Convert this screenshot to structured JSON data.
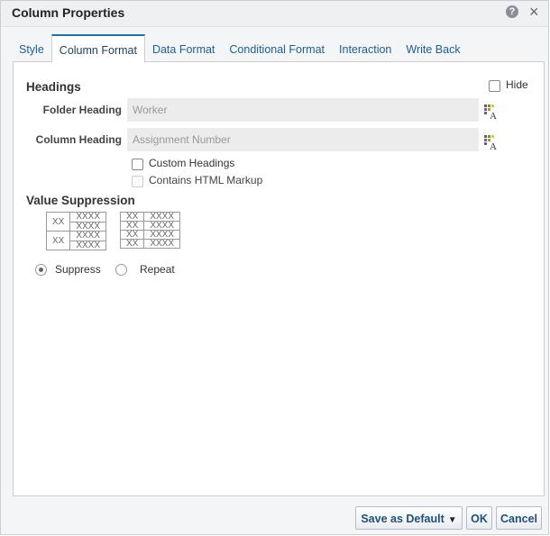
{
  "dialog": {
    "title": "Column Properties",
    "help_icon": "help-icon",
    "close_icon": "close-icon"
  },
  "tabs": [
    {
      "label": "Style",
      "active": false
    },
    {
      "label": "Column Format",
      "active": true
    },
    {
      "label": "Data Format",
      "active": false
    },
    {
      "label": "Conditional Format",
      "active": false
    },
    {
      "label": "Interaction",
      "active": false
    },
    {
      "label": "Write Back",
      "active": false
    }
  ],
  "headings": {
    "section_title": "Headings",
    "hide_label": "Hide",
    "hide_checked": false,
    "folder_heading_label": "Folder Heading",
    "folder_heading_value": "Worker",
    "column_heading_label": "Column Heading",
    "column_heading_value": "Assignment Number",
    "custom_headings_label": "Custom Headings",
    "custom_headings_checked": false,
    "html_markup_label": "Contains HTML Markup",
    "html_markup_checked": false,
    "html_markup_disabled": true
  },
  "value_suppression": {
    "section_title": "Value Suppression",
    "suppress_preview": {
      "group": "XX",
      "cell": "XXXX"
    },
    "repeat_preview": {
      "group": "XX",
      "cell": "XXXX"
    },
    "suppress_label": "Suppress",
    "repeat_label": "Repeat",
    "selected": "Suppress"
  },
  "footer": {
    "save_default_label": "Save as Default",
    "ok_label": "OK",
    "cancel_label": "Cancel"
  },
  "colors": {
    "accent": "#1f6fb5",
    "link": "#1d5f96"
  }
}
